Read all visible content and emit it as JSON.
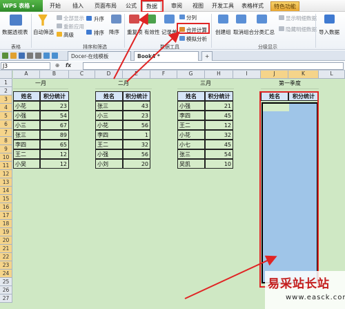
{
  "app": {
    "name": "WPS 表格"
  },
  "menu": [
    "开始",
    "插入",
    "页面布局",
    "公式",
    "数据",
    "审阅",
    "视图",
    "开发工具",
    "表格样式",
    "特色功能"
  ],
  "ribbon": {
    "pivot": "数据透视表",
    "autofilter": "自动筛选",
    "show_all": "全部显示",
    "reapply": "重新应用",
    "advanced": "高级",
    "sort_asc": "升序",
    "sort": "排序",
    "sort_desc": "降序",
    "duplicates": "重复项",
    "validity": "有效性",
    "records": "记录单",
    "split": "分列",
    "merge_calc": "合并计算",
    "whatif": "模拟分析",
    "create_group": "创建组",
    "ungroup": "取消组合",
    "subtotal": "分类汇总",
    "show_detail": "显示明细数据",
    "hide_detail": "隐藏明细数据",
    "import": "导入数据",
    "group_table": "表格",
    "group_sortfilter": "排序和筛选",
    "group_tools": "数据工具",
    "group_outline": "分级显示"
  },
  "tabs": {
    "docer": "Docer-在线模板",
    "book": "Book4 *",
    "add": "+"
  },
  "formula_bar": {
    "cell_ref": "J3",
    "fx": "fx",
    "value": ""
  },
  "columns": [
    "A",
    "B",
    "C",
    "D",
    "E",
    "F",
    "G",
    "H",
    "I",
    "J",
    "K",
    "L"
  ],
  "rows": [
    "1",
    "2",
    "3",
    "4",
    "5",
    "6",
    "7",
    "8",
    "9",
    "10",
    "11",
    "12",
    "13",
    "14",
    "15",
    "16",
    "17",
    "18",
    "19",
    "20",
    "21",
    "22",
    "23",
    "24",
    "25",
    "26",
    "27"
  ],
  "sheet": {
    "jan": {
      "title": "一月",
      "h_name": "姓名",
      "h_score": "积分统计",
      "rows": [
        [
          "小花",
          "23"
        ],
        [
          "小强",
          "54"
        ],
        [
          "小三",
          "67"
        ],
        [
          "张三",
          "89"
        ],
        [
          "李四",
          "65"
        ],
        [
          "王二",
          "12"
        ],
        [
          "小吴",
          "12"
        ]
      ]
    },
    "feb": {
      "title": "二月",
      "h_name": "姓名",
      "h_score": "积分统计",
      "rows": [
        [
          "张三",
          "43"
        ],
        [
          "小三",
          "23"
        ],
        [
          "小花",
          "56"
        ],
        [
          "李四",
          "1"
        ],
        [
          "王二",
          "32"
        ],
        [
          "小强",
          "56"
        ],
        [
          "小刘",
          "20"
        ]
      ]
    },
    "mar": {
      "title": "三月",
      "h_name": "姓名",
      "h_score": "积分统计",
      "rows": [
        [
          "小强",
          "21"
        ],
        [
          "李四",
          "45"
        ],
        [
          "王二",
          "12"
        ],
        [
          "小花",
          "32"
        ],
        [
          "小七",
          "45"
        ],
        [
          "张三",
          "54"
        ],
        [
          "吴凯",
          "10"
        ]
      ]
    },
    "q1": {
      "title": "第一季度",
      "h_name": "姓名",
      "h_score": "积分统计"
    }
  },
  "watermark": {
    "main": "易采站长站",
    "url": "www.easck.com"
  },
  "colors": {
    "accent_red": "#e02424",
    "selection": "#9fc5e8",
    "grid_bg": "#cfe8c4",
    "header_blue": "#d6e5f7"
  }
}
